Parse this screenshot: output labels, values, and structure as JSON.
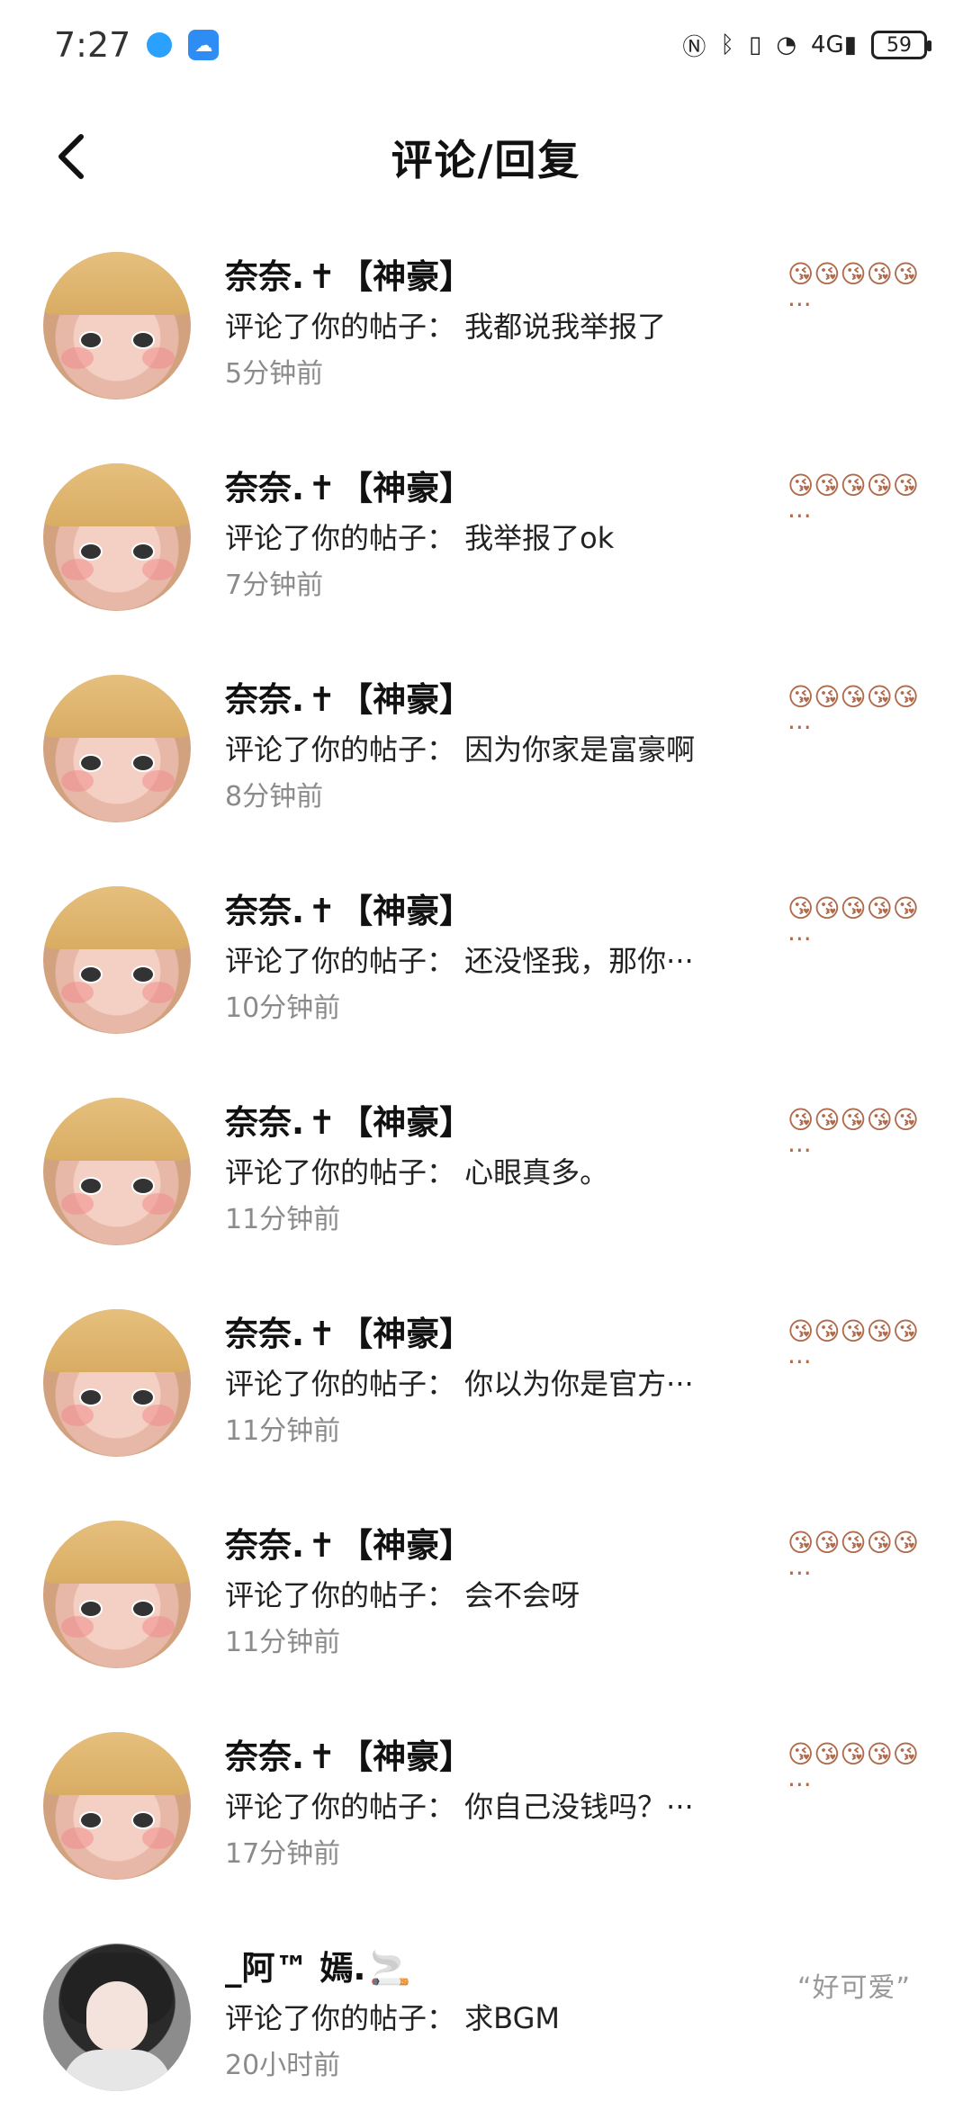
{
  "status": {
    "time": "7:27",
    "battery": "59"
  },
  "header": {
    "title": "评论/回复",
    "back_icon": "chevron-left-icon"
  },
  "items": [
    {
      "name": "奈奈.",
      "tag": "【神豪】",
      "comment": "评论了你的帖子： 我都说我举报了",
      "time": "5分钟前",
      "thumb": "😘😘😘😘😘···"
    },
    {
      "name": "奈奈.",
      "tag": "【神豪】",
      "comment": "评论了你的帖子： 我举报了ok",
      "time": "7分钟前",
      "thumb": "😘😘😘😘😘···"
    },
    {
      "name": "奈奈.",
      "tag": "【神豪】",
      "comment": "评论了你的帖子： 因为你家是富豪啊",
      "time": "8分钟前",
      "thumb": "😘😘😘😘😘···"
    },
    {
      "name": "奈奈.",
      "tag": "【神豪】",
      "comment": "评论了你的帖子： 还没怪我，那你···",
      "time": "10分钟前",
      "thumb": "😘😘😘😘😘···"
    },
    {
      "name": "奈奈.",
      "tag": "【神豪】",
      "comment": "评论了你的帖子： 心眼真多。",
      "time": "11分钟前",
      "thumb": "😘😘😘😘😘···"
    },
    {
      "name": "奈奈.",
      "tag": "【神豪】",
      "comment": "评论了你的帖子： 你以为你是官方···",
      "time": "11分钟前",
      "thumb": "😘😘😘😘😘···"
    },
    {
      "name": "奈奈.",
      "tag": "【神豪】",
      "comment": "评论了你的帖子： 会不会呀",
      "time": "11分钟前",
      "thumb": "😘😘😘😘😘···"
    },
    {
      "name": "奈奈.",
      "tag": "【神豪】",
      "comment": "评论了你的帖子： 你自己没钱吗？···",
      "time": "17分钟前",
      "thumb": "😘😘😘😘😘···"
    },
    {
      "name": "_阿™ 嫣.",
      "tag": "",
      "comment": "评论了你的帖子： 求BGM",
      "time": "20小时前",
      "thumb": "“好可爱”"
    }
  ]
}
